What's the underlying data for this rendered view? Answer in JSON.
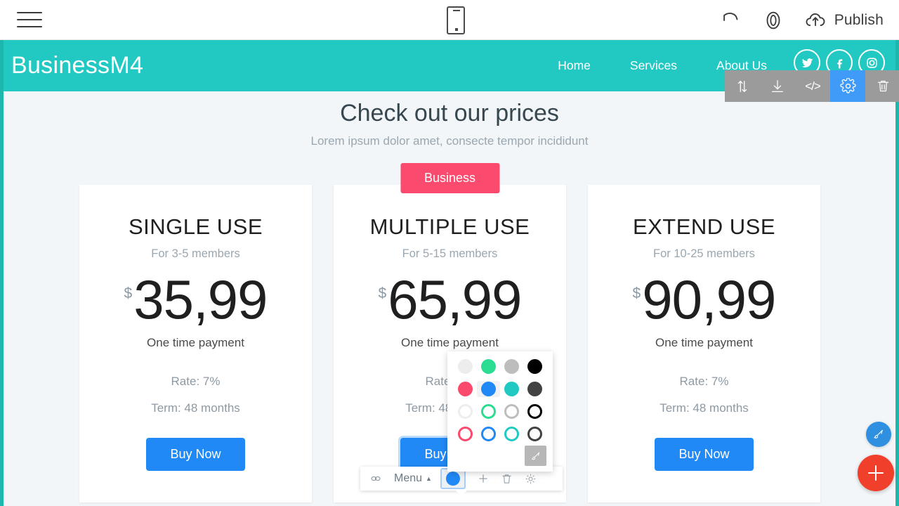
{
  "editor": {
    "menu_icon": "hamburger-menu-icon",
    "device_icon": "mobile-device-icon",
    "undo_icon": "undo-icon",
    "preview_icon": "eye-preview-icon",
    "publish_icon": "cloud-upload-icon",
    "publish_label": "Publish"
  },
  "element_toolbar": {
    "items": [
      {
        "name": "move-updown",
        "icon": "arrows-up-down-icon",
        "active": false
      },
      {
        "name": "download",
        "icon": "download-icon",
        "active": false
      },
      {
        "name": "code",
        "icon": "code-icon",
        "label": "</>",
        "active": false
      },
      {
        "name": "settings",
        "icon": "gear-icon",
        "active": true
      },
      {
        "name": "delete",
        "icon": "trash-icon",
        "active": false
      }
    ],
    "active_color": "#3f9bf7",
    "background": "#9b9b9b"
  },
  "site": {
    "brand": "BusinessM4",
    "nav_bg": "#22c9c3",
    "nav_links": [
      {
        "label": "Home"
      },
      {
        "label": "Services"
      },
      {
        "label": "About Us"
      }
    ],
    "socials": [
      {
        "name": "twitter-icon"
      },
      {
        "name": "facebook-icon"
      },
      {
        "name": "instagram-icon"
      }
    ]
  },
  "content": {
    "title": "Check out our prices",
    "subtitle": "Lorem ipsum dolor amet, consecte tempor incididunt",
    "currency": "$",
    "cards": [
      {
        "badge": null,
        "title": "SINGLE USE",
        "members": "For 3-5 members",
        "price": "35,99",
        "payment": "One time payment",
        "rate": "Rate: 7%",
        "term": "Term: 48 months",
        "button": "Buy Now"
      },
      {
        "badge": "Business",
        "title": "MULTIPLE USE",
        "members": "For 5-15 members",
        "price": "65,99",
        "payment": "One time payment",
        "rate": "Rate: 7%",
        "term": "Term: 48 months",
        "button": "Buy Now"
      },
      {
        "badge": null,
        "title": "EXTEND USE",
        "members": "For 10-25 members",
        "price": "90,99",
        "payment": "One time payment",
        "rate": "Rate: 7%",
        "term": "Term: 48 months",
        "button": "Buy Now"
      }
    ]
  },
  "color_picker": {
    "selected_index": 5,
    "swatches": [
      {
        "color": "#ededed",
        "style": "fill"
      },
      {
        "color": "#2bdc93",
        "style": "fill"
      },
      {
        "color": "#bdbdbd",
        "style": "fill"
      },
      {
        "color": "#000000",
        "style": "fill"
      },
      {
        "color": "#fa4a6d",
        "style": "fill"
      },
      {
        "color": "#2089f5",
        "style": "fill"
      },
      {
        "color": "#22c9c3",
        "style": "fill"
      },
      {
        "color": "#424242",
        "style": "fill"
      },
      {
        "color": "#ededed",
        "style": "ring"
      },
      {
        "color": "#2bdc93",
        "style": "ring"
      },
      {
        "color": "#bdbdbd",
        "style": "ring"
      },
      {
        "color": "#000000",
        "style": "ring"
      },
      {
        "color": "#fa4a6d",
        "style": "ring"
      },
      {
        "color": "#2089f5",
        "style": "ring"
      },
      {
        "color": "#22c9c3",
        "style": "ring"
      },
      {
        "color": "#424242",
        "style": "ring"
      }
    ],
    "custom_button_icon": "paintbrush-icon"
  },
  "inline_toolbar": {
    "link_icon": "link-icon",
    "menu_label": "Menu",
    "menu_caret": "▲",
    "color_swatch": "#2089f5",
    "add_icon": "plus-icon",
    "delete_icon": "trash-icon",
    "settings_icon": "brightness-settings-icon"
  },
  "fabs": {
    "pen": {
      "icon": "pen-icon",
      "color": "#2f8fe0"
    },
    "add": {
      "icon": "plus-icon",
      "color": "#f0402b"
    }
  }
}
